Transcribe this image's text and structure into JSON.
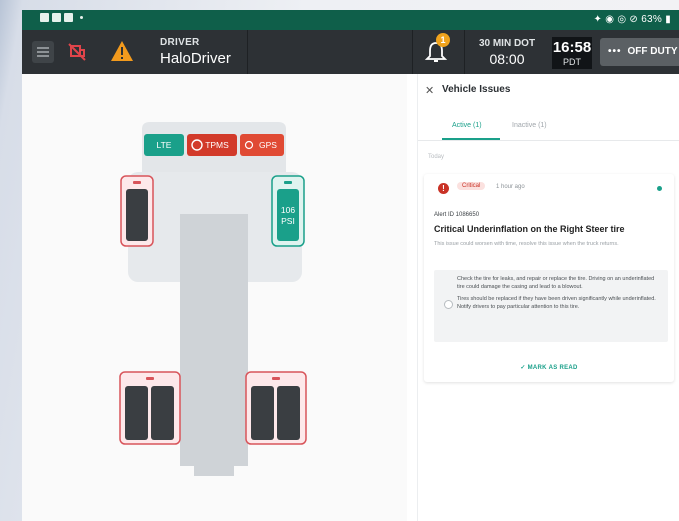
{
  "status_bar": {
    "right_text": "63%"
  },
  "app_bar": {
    "driver_label": "DRIVER",
    "driver_name": "HaloDriver",
    "notification_count": "1",
    "dot_label": "30 MIN DOT",
    "dot_value": "08:00",
    "clock_time": "16:58",
    "clock_tz": "PDT",
    "duty_status": "OFF DUTY"
  },
  "truck_view": {
    "badges": [
      {
        "label": "LTE",
        "color": "#1aa08a"
      },
      {
        "label": "TPMS",
        "color": "#d23a2a"
      },
      {
        "label": "GPS",
        "color": "#e04a34"
      }
    ],
    "pressure_reading": {
      "value": "106",
      "unit": "PSI"
    },
    "colors": {
      "alert": "#d8545a",
      "ok": "#1aa08a",
      "tire": "#3a3e42",
      "chassis": "#dfe2e5"
    }
  },
  "vehicle_issues": {
    "title": "Vehicle Issues",
    "tabs": [
      {
        "label": "Active (1)",
        "active": true
      },
      {
        "label": "Inactive (1)",
        "active": false
      }
    ],
    "section_label": "Today",
    "issue": {
      "severity": "Critical",
      "time_ago": "1 hour ago",
      "alert_id": "Alert ID 1086650",
      "title": "Critical Underinflation on the Right Steer tire",
      "description": "This issue could worsen with time, resolve this issue when the truck returns.",
      "recommendation_1": "Check the tire for leaks, and repair or replace the tire. Driving on an underinflated tire could damage the casing and lead to a blowout.",
      "recommendation_2": "Tires should be replaced if they have been driven significantly while underinflated. Notify drivers to pay particular attention to this tire.",
      "action_label": "✓ MARK AS READ"
    }
  }
}
